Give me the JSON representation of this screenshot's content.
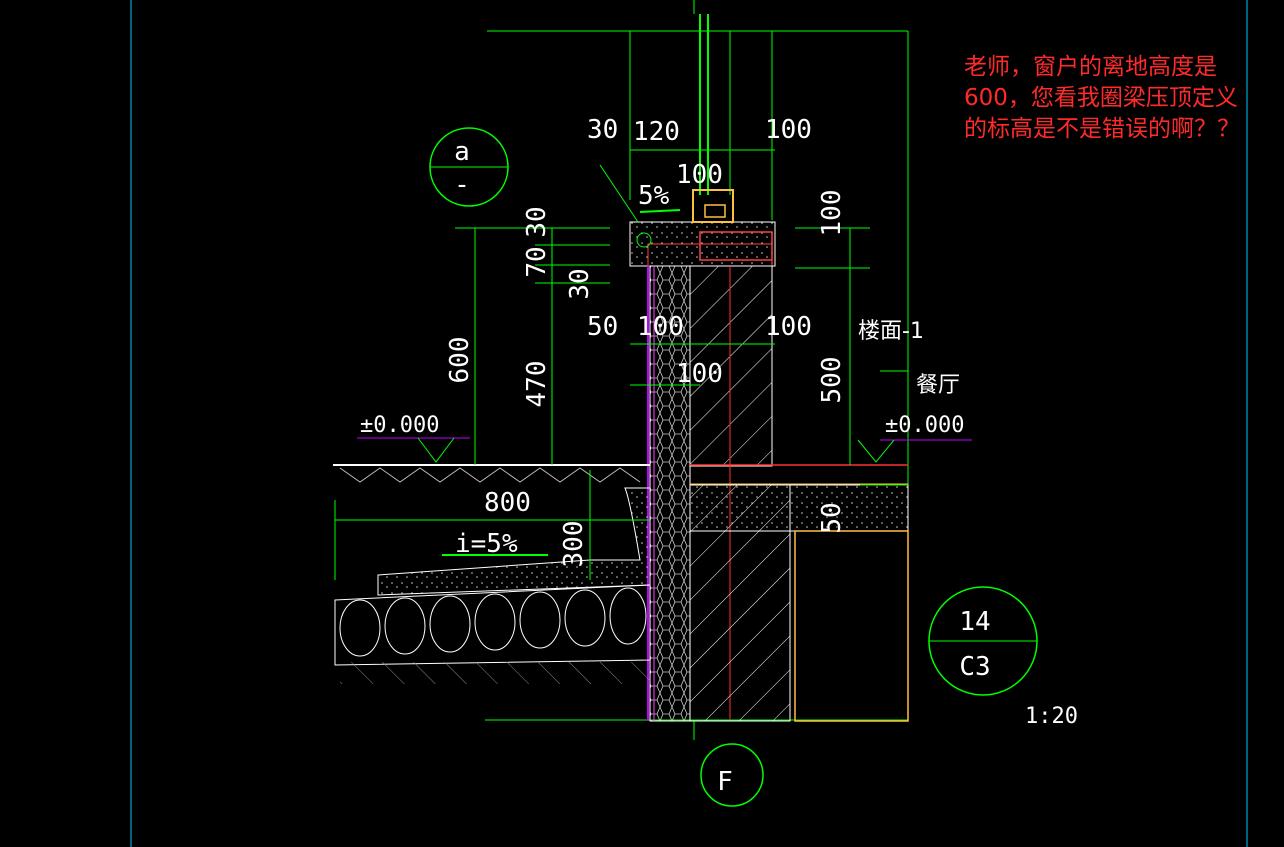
{
  "annotation_note": {
    "lines": [
      "老师，窗户的离地高度是",
      "600，您看我圈梁压顶定义",
      "的标高是不是错误的啊？？"
    ]
  },
  "detail_bubble_top": {
    "top": "a",
    "bottom": "-"
  },
  "detail_bubble_right": {
    "top": "14",
    "bottom": "C3"
  },
  "axis_bubble": {
    "label": "F"
  },
  "scale": "1:20",
  "dimensions": {
    "d30_top": "30",
    "d120": "120",
    "d100_top_right": "100",
    "d100_mid": "100",
    "d5pct": "5%",
    "v30": "30",
    "v70": "70",
    "v30b": "30",
    "v100_right": "100",
    "v600": "600",
    "v470": "470",
    "d50": "50",
    "d100_a": "100",
    "d100_b": "100",
    "d100_c": "100",
    "v500": "500",
    "v50": "50",
    "d800": "800",
    "slope": "i=5%",
    "v300": "300"
  },
  "elevations": {
    "left": "±0.000",
    "right": "±0.000"
  },
  "labels": {
    "floor": "楼面-1",
    "room": "餐厅"
  },
  "colors": {
    "background": "#000000",
    "line": "#00ff00",
    "note": "#ff2a2a",
    "cyan": "#00c8ff",
    "magenta": "#c000ff"
  }
}
